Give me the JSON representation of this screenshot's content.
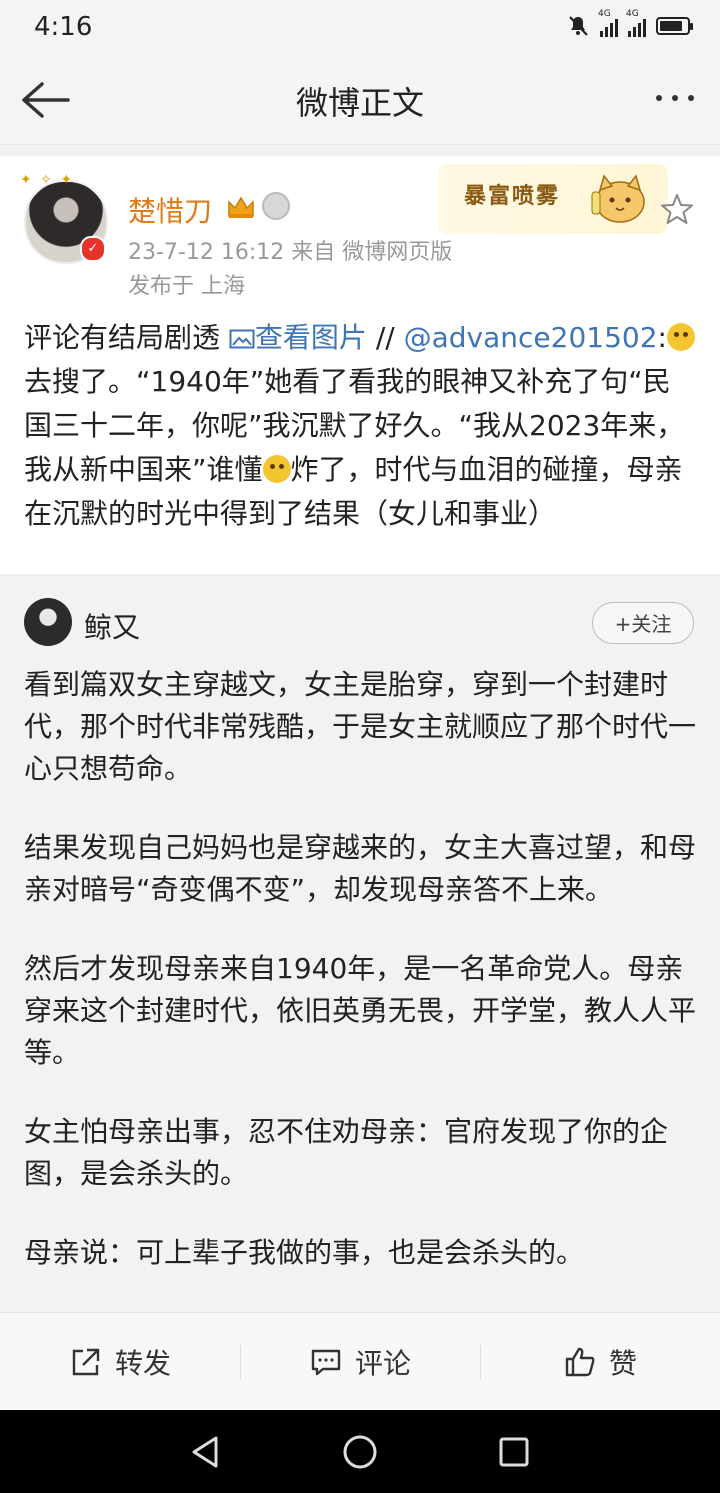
{
  "status_bar": {
    "time": "4:16",
    "signal1": "4G",
    "signal2": "4G",
    "battery_level": 0.85
  },
  "nav": {
    "title": "微博正文"
  },
  "post": {
    "username": "楚惜刀",
    "meta": "23-7-12 16:12  来自 微博网页版",
    "location": "发布于 上海",
    "sticker_text": "暴富喷雾",
    "text_intro": "评论有结局剧透 ",
    "view_image": "查看图片",
    "separator": " //",
    "mention": "@advance201502",
    "text_colon": ":",
    "text_part1": "去搜了。“1940年”她看了看我的眼神又补充了句“民国三十二年，你呢”我沉默了好久。“我从2023年来，我从新中国来”谁懂",
    "text_part2": "炸了，时代与血泪的碰撞，母亲在沉默的时光中得到了结果（女儿和事业）"
  },
  "repost": {
    "username": "鲸又",
    "follow_label": "+关注",
    "paragraphs": [
      "看到篇双女主穿越文，女主是胎穿，穿到一个封建时代，那个时代非常残酷，于是女主就顺应了那个时代一心只想苟命。",
      "结果发现自己妈妈也是穿越来的，女主大喜过望，和母亲对暗号“奇变偶不变”，却发现母亲答不上来。",
      "然后才发现母亲来自1940年，是一名革命党人。母亲穿来这个封建时代，依旧英勇无畏，开学堂，教人人平等。",
      "女主怕母亲出事，忍不住劝母亲：官府发现了你的企图，是会杀头的。",
      "母亲说：可上辈子我做的事，也是会杀头的。"
    ]
  },
  "actions": {
    "repost": "转发",
    "comment": "评论",
    "like": "赞"
  },
  "colors": {
    "username": "#e07c18",
    "link": "#3f74b6",
    "meta": "#999999"
  }
}
